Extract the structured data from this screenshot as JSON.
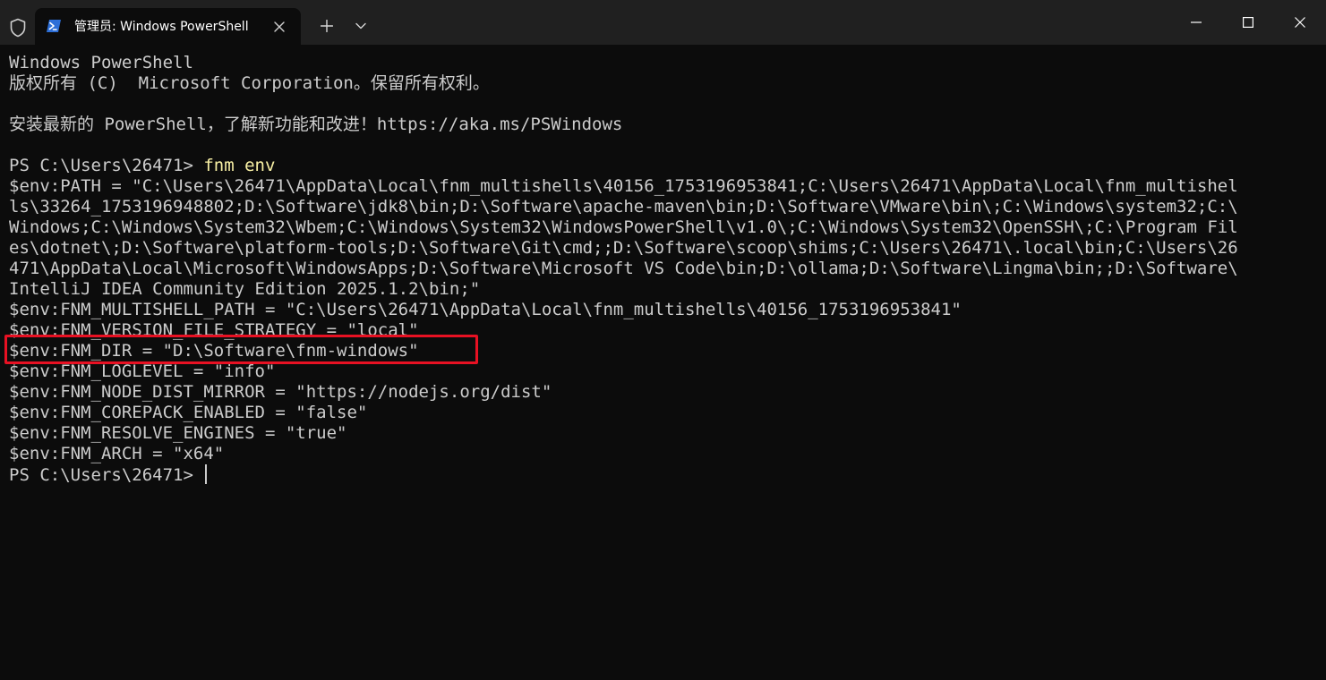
{
  "titlebar": {
    "tab_title": "管理员: Windows PowerShell",
    "icons": {
      "admin": "shield-icon",
      "tab": "powershell-icon",
      "close_tab": "close-icon",
      "new_tab": "plus-icon",
      "dropdown": "chevron-down-icon",
      "minimize": "minimize-icon",
      "maximize": "maximize-icon",
      "close_window": "close-icon"
    }
  },
  "terminal": {
    "lines": [
      "Windows PowerShell",
      "版权所有 (C)  Microsoft Corporation。保留所有权利。",
      "",
      "安装最新的 PowerShell，了解新功能和改进！https://aka.ms/PSWindows",
      "",
      "",
      "$env:PATH = \"C:\\Users\\26471\\AppData\\Local\\fnm_multishells\\40156_1753196953841;C:\\Users\\26471\\AppData\\Local\\fnm_multishel",
      "ls\\33264_1753196948802;D:\\Software\\jdk8\\bin;D:\\Software\\apache-maven\\bin;D:\\Software\\VMware\\bin\\;C:\\Windows\\system32;C:\\",
      "Windows;C:\\Windows\\System32\\Wbem;C:\\Windows\\System32\\WindowsPowerShell\\v1.0\\;C:\\Windows\\System32\\OpenSSH\\;C:\\Program Fil",
      "es\\dotnet\\;D:\\Software\\platform-tools;D:\\Software\\Git\\cmd;;D:\\Software\\scoop\\shims;C:\\Users\\26471\\.local\\bin;C:\\Users\\26",
      "471\\AppData\\Local\\Microsoft\\WindowsApps;D:\\Software\\Microsoft VS Code\\bin;D:\\ollama;D:\\Software\\Lingma\\bin;;D:\\Software\\",
      "IntelliJ IDEA Community Edition 2025.1.2\\bin;\"",
      "$env:FNM_MULTISHELL_PATH = \"C:\\Users\\26471\\AppData\\Local\\fnm_multishells\\40156_1753196953841\"",
      "$env:FNM_VERSION_FILE_STRATEGY = \"local\"",
      "$env:FNM_DIR = \"D:\\Software\\fnm-windows\"",
      "$env:FNM_LOGLEVEL = \"info\"",
      "$env:FNM_NODE_DIST_MIRROR = \"https://nodejs.org/dist\"",
      "$env:FNM_COREPACK_ENABLED = \"false\"",
      "$env:FNM_RESOLVE_ENGINES = \"true\"",
      "$env:FNM_ARCH = \"x64\""
    ],
    "command_prompt": "PS C:\\Users\\26471> ",
    "command": "fnm env",
    "final_prompt": "PS C:\\Users\\26471> "
  },
  "colors": {
    "background": "#0c0c0c",
    "titlebar": "#202020",
    "text": "#cccccc",
    "command": "#f9f1a5",
    "highlight_border": "#e81123"
  }
}
